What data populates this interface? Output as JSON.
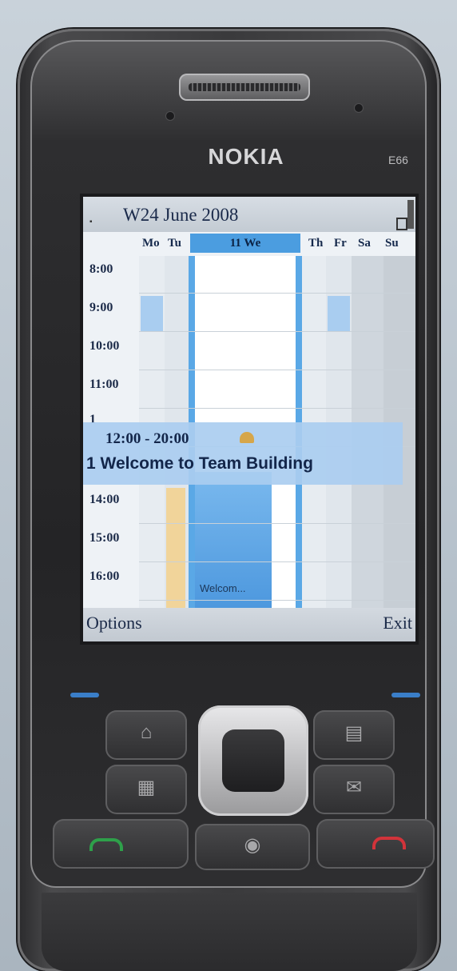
{
  "device": {
    "brand": "NOKIA",
    "model": "E66"
  },
  "calendar": {
    "title": "W24 June 2008",
    "days": [
      "Mo",
      "Tu",
      "11 We",
      "Th",
      "Fr",
      "Sa",
      "Su"
    ],
    "times": [
      "8:00",
      "9:00",
      "10:00",
      "11:00",
      "14:00",
      "15:00",
      "16:00"
    ],
    "event": {
      "time": "12:00 - 20:00",
      "title": "Welcome to Team Building",
      "short": "Welcom...",
      "hour_fragment": "1",
      "row_fragment": "1"
    },
    "softkeys": {
      "left": "Options",
      "right": "Exit"
    }
  },
  "colors": {
    "accent": "#4b9de0",
    "call": "#2ea04a",
    "end": "#d2333a"
  },
  "icons": [
    "home-icon",
    "notes-icon",
    "calendar-icon",
    "mail-icon",
    "call-icon",
    "end-call-icon",
    "speaker-icon"
  ]
}
